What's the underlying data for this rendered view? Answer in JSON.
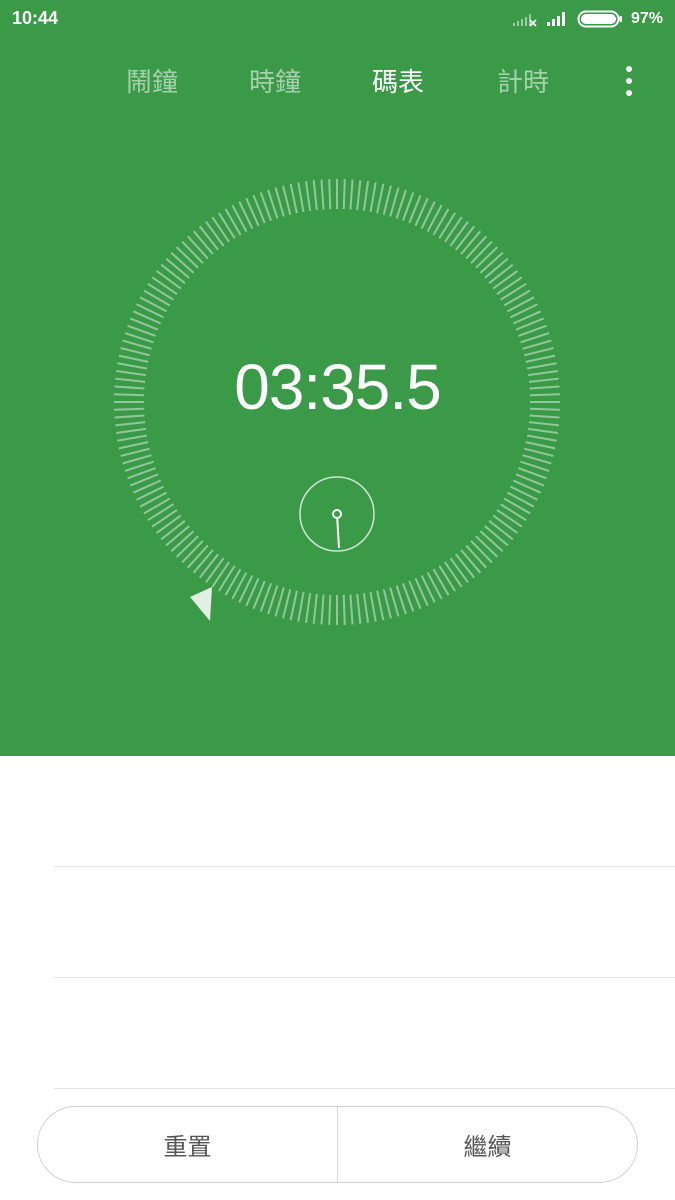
{
  "status_bar": {
    "time": "10:44",
    "battery_percent": "97%",
    "icons": [
      "no-sim-signal-icon",
      "signal-icon",
      "battery-icon"
    ]
  },
  "tabs": [
    {
      "label": "鬧鐘",
      "active": false
    },
    {
      "label": "時鐘",
      "active": false
    },
    {
      "label": "碼表",
      "active": true
    },
    {
      "label": "計時",
      "active": false
    }
  ],
  "stopwatch": {
    "display": "03:35.5"
  },
  "controls": {
    "reset_label": "重置",
    "resume_label": "繼續"
  },
  "colors": {
    "header_bg": "#3a9a48",
    "text_on_header": "#ffffff"
  }
}
